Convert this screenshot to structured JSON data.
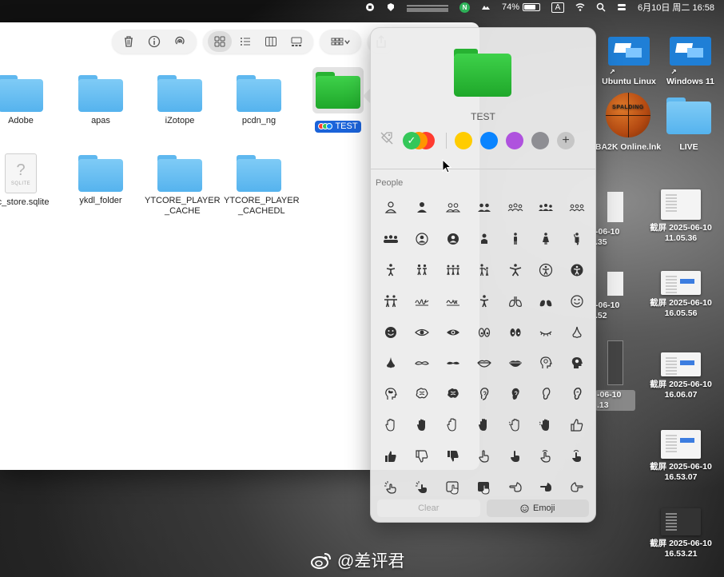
{
  "menubar": {
    "battery_percent": "74%",
    "input_method": "A",
    "datetime": "6月10日 周二  16:58"
  },
  "finder": {
    "files": [
      {
        "label": "Adobe",
        "kind": "folder"
      },
      {
        "label": "apas",
        "kind": "folder"
      },
      {
        "label": "iZotope",
        "kind": "folder"
      },
      {
        "label": "pcdn_ng",
        "kind": "folder"
      },
      {
        "label": "TEST",
        "kind": "folder-green",
        "selected": true
      },
      {
        "label": "nc_store.sqlite",
        "kind": "sqlite"
      },
      {
        "label": "ykdl_folder",
        "kind": "folder"
      },
      {
        "label": "YTCORE_PLAYER\n_CACHE",
        "kind": "folder"
      },
      {
        "label": "YTCORE_PLAYER\n_CACHEDL",
        "kind": "folder"
      }
    ],
    "sqlite_ext": "SQLITE"
  },
  "popover": {
    "folder_name": "TEST",
    "colors": {
      "green": "#34c759",
      "orange": "#ff9500",
      "red": "#ff3b30",
      "yellow": "#ffcc00",
      "blue": "#0a84ff",
      "purple": "#af52de",
      "gray": "#8e8e93"
    },
    "add_symbol": "+",
    "section_title": "People",
    "clear_label": "Clear",
    "emoji_label": "Emoji"
  },
  "desktop": {
    "items": [
      {
        "label": "Ubuntu Linux"
      },
      {
        "label": "Windows 11"
      },
      {
        "label": "BA2K Online.lnk",
        "brand": "SPALDING"
      },
      {
        "label": "LIVE"
      },
      {
        "label": "截屏 2025-06-10\n11.05.36"
      },
      {
        "label": "截屏 2025-06-10\n16.05.56"
      },
      {
        "label": "截屏 2025-06-10\n16.06.07"
      },
      {
        "label": "截屏 2025-06-10\n16.53.07"
      },
      {
        "label": "截屏 2025-06-10\n16.53.21"
      },
      {
        "label": "-06-10\n.35"
      },
      {
        "label": "-06-10\n.52"
      },
      {
        "label": "-06-10\n.13"
      }
    ]
  },
  "watermark": "@差评君"
}
